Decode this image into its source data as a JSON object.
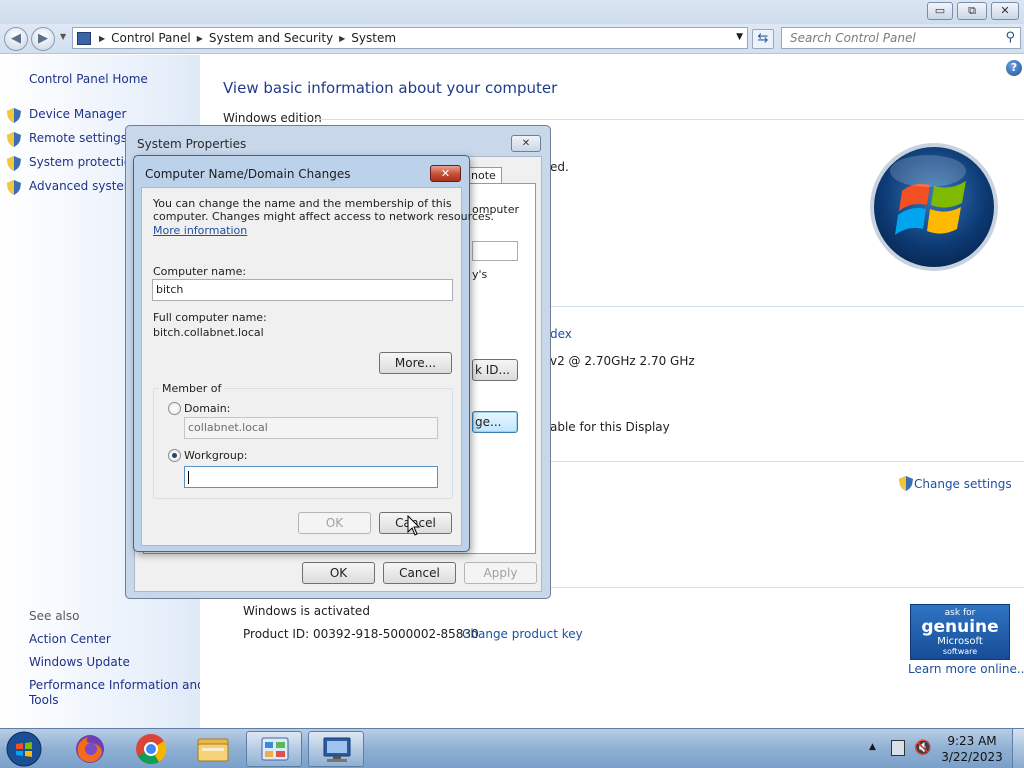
{
  "address": {
    "crumbs": [
      "Control Panel",
      "System and Security",
      "System"
    ],
    "search_placeholder": "Search Control Panel"
  },
  "left_pane": {
    "home": "Control Panel Home",
    "tasks": [
      "Device Manager",
      "Remote settings",
      "System protection",
      "Advanced system"
    ],
    "see_also_header": "See also",
    "see_also": [
      "Action Center",
      "Windows Update",
      "Performance Information and",
      "Tools"
    ]
  },
  "main": {
    "title": "View basic information about your computer",
    "edition_header": "Windows edition",
    "partial_reserved": "ed.",
    "rating_link_fragment": "dex",
    "processor_fragment": "v2 @ 2.70GHz   2.70 GHz",
    "pen_touch_fragment": "able for this Display",
    "change_settings": "Change settings",
    "activated": "Windows is activated",
    "product_id": "Product ID: 00392-918-5000002-85830",
    "change_product_key": "Change product key",
    "learn_more": "Learn more online...",
    "genuine": {
      "ask": "ask for",
      "main": "genuine",
      "brand": "Microsoft",
      "sub": "software"
    }
  },
  "system_properties": {
    "title": "System Properties",
    "tab_fragment": "note",
    "computer_fragment": "omputer",
    "ys_fragment": "y's",
    "id_button": "k ID...",
    "change_button": "ge...",
    "ok": "OK",
    "cancel": "Cancel",
    "apply": "Apply"
  },
  "computer_name_dialog": {
    "title": "Computer Name/Domain Changes",
    "intro_line1": "You can change the name and the membership of this",
    "intro_line2": "computer. Changes might affect access to network resources.",
    "more_info": "More information",
    "computer_name_label": "Computer name:",
    "computer_name_value": "bitch",
    "full_name_label": "Full computer name:",
    "full_name_value": "bitch.collabnet.local",
    "more_button": "More...",
    "member_of": "Member of",
    "domain_label": "Domain:",
    "domain_value": "collabnet.local",
    "workgroup_label": "Workgroup:",
    "workgroup_value": "",
    "ok": "OK",
    "cancel": "Cancel"
  },
  "taskbar": {
    "time": "9:23 AM",
    "date": "3/22/2023"
  }
}
